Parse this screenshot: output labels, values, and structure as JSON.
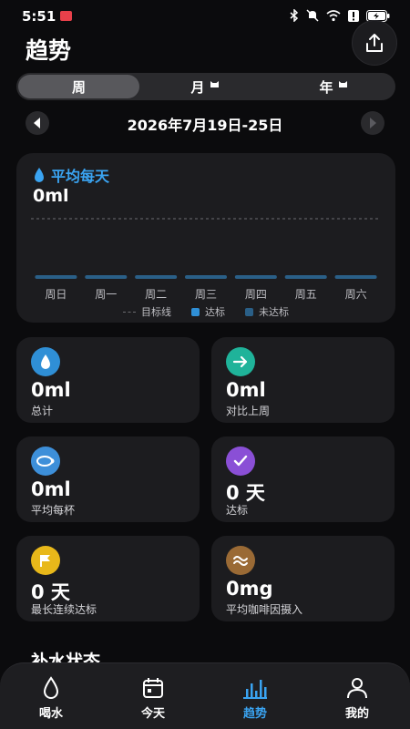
{
  "status_bar": {
    "time": "5:51"
  },
  "header": {
    "title": "趋势"
  },
  "period_tabs": [
    {
      "label": "周",
      "active": true
    },
    {
      "label": "月",
      "active": false
    },
    {
      "label": "年",
      "active": false
    }
  ],
  "week_nav": {
    "range": "2026年7月19日-25日"
  },
  "chart_card": {
    "heading": "平均每天",
    "value": "0ml"
  },
  "chart_data": {
    "type": "bar",
    "categories": [
      "周日",
      "周一",
      "周二",
      "周三",
      "周四",
      "周五",
      "周六"
    ],
    "values": [
      0,
      0,
      0,
      0,
      0,
      0,
      0
    ],
    "goal_line": true,
    "legend": [
      "目标线",
      "达标",
      "未达标"
    ],
    "colors": {
      "achieved": "#2f8fd6",
      "not_achieved": "#2a5f87",
      "goal_line": "#6b6b70"
    }
  },
  "stats": [
    {
      "value": "0ml",
      "label": "总计",
      "icon": "water-drop-icon",
      "color": "#2f8fd6"
    },
    {
      "value": "0ml",
      "label": "对比上周",
      "icon": "arrow-right-icon",
      "color": "#1fb39a"
    },
    {
      "value": "0ml",
      "label": "平均每杯",
      "icon": "cup-icon",
      "color": "#3d8fd9"
    },
    {
      "value": "0 天",
      "label": "达标",
      "icon": "checkmark-icon",
      "color": "#8a4fd6"
    },
    {
      "value": "0 天",
      "label": "最长连续达标",
      "icon": "flag-icon",
      "color": "#e8b81a"
    },
    {
      "value": "0mg",
      "label": "平均咖啡因摄入",
      "icon": "coffee-icon",
      "color": "#9a6a35"
    }
  ],
  "section": {
    "title": "补水状态"
  },
  "tab_bar": [
    {
      "label": "喝水",
      "icon": "water-drop-icon",
      "active": false
    },
    {
      "label": "今天",
      "icon": "calendar-icon",
      "active": false
    },
    {
      "label": "趋势",
      "icon": "bar-chart-icon",
      "active": true
    },
    {
      "label": "我的",
      "icon": "person-icon",
      "active": false
    }
  ]
}
